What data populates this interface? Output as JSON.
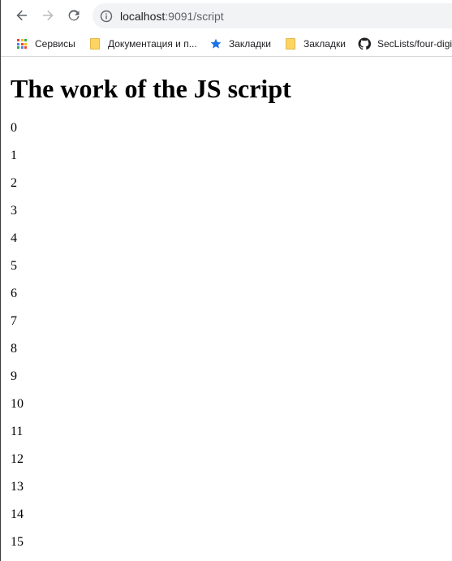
{
  "browser": {
    "url_host": "localhost",
    "url_path": ":9091/script",
    "colors": {
      "omnibox_bg": "#f1f3f4",
      "star": "#1a73e8",
      "folder": "#fcd462"
    },
    "bookmarks": [
      {
        "label": "Сервисы",
        "icon": "apps-grid-icon"
      },
      {
        "label": "Документация и п...",
        "icon": "folder-icon"
      },
      {
        "label": "Закладки",
        "icon": "star-icon"
      },
      {
        "label": "Закладки",
        "icon": "folder-icon"
      },
      {
        "label": "SecLists/four-digi",
        "icon": "github-icon"
      }
    ]
  },
  "page": {
    "heading": "The work of the JS script",
    "numbers": [
      "0",
      "1",
      "2",
      "3",
      "4",
      "5",
      "6",
      "7",
      "8",
      "9",
      "10",
      "11",
      "12",
      "13",
      "14",
      "15"
    ]
  }
}
